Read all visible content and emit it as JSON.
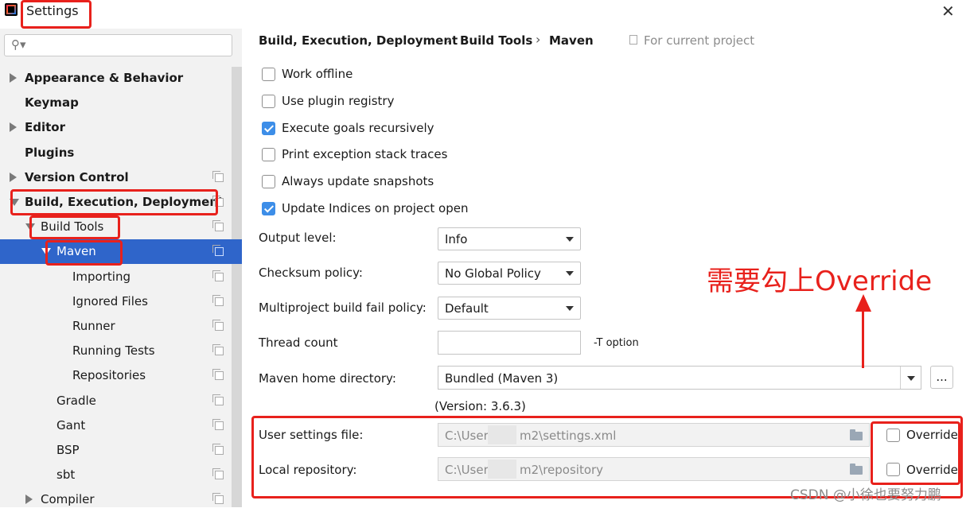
{
  "window": {
    "title": "Settings"
  },
  "sidebar": {
    "search": {
      "placeholder": ""
    },
    "items": [
      {
        "label": "Appearance & Behavior",
        "arrow": "right",
        "bold": true,
        "indent": 0
      },
      {
        "label": "Keymap",
        "arrow": "none",
        "bold": true,
        "indent": 0
      },
      {
        "label": "Editor",
        "arrow": "right",
        "bold": true,
        "indent": 0
      },
      {
        "label": "Plugins",
        "arrow": "none",
        "bold": true,
        "indent": 0
      },
      {
        "label": "Version Control",
        "arrow": "right",
        "bold": true,
        "indent": 0
      },
      {
        "label": "Build, Execution, Deployment",
        "arrow": "down",
        "bold": true,
        "indent": 0
      },
      {
        "label": "Build Tools",
        "arrow": "down",
        "bold": false,
        "indent": 1
      },
      {
        "label": "Maven",
        "arrow": "down",
        "bold": false,
        "indent": 2,
        "selected": true
      },
      {
        "label": "Importing",
        "arrow": "none",
        "bold": false,
        "indent": 3
      },
      {
        "label": "Ignored Files",
        "arrow": "none",
        "bold": false,
        "indent": 3
      },
      {
        "label": "Runner",
        "arrow": "none",
        "bold": false,
        "indent": 3
      },
      {
        "label": "Running Tests",
        "arrow": "none",
        "bold": false,
        "indent": 3
      },
      {
        "label": "Repositories",
        "arrow": "none",
        "bold": false,
        "indent": 3
      },
      {
        "label": "Gradle",
        "arrow": "none",
        "bold": false,
        "indent": 2
      },
      {
        "label": "Gant",
        "arrow": "none",
        "bold": false,
        "indent": 2
      },
      {
        "label": "BSP",
        "arrow": "none",
        "bold": false,
        "indent": 2
      },
      {
        "label": "sbt",
        "arrow": "none",
        "bold": false,
        "indent": 2
      },
      {
        "label": "Compiler",
        "arrow": "right",
        "bold": false,
        "indent": 1
      }
    ]
  },
  "breadcrumb": {
    "parts": [
      "Build, Execution, Deployment",
      "Build Tools",
      "Maven"
    ],
    "separator": "›",
    "scope": "For current project"
  },
  "options": [
    {
      "label": "Work offline",
      "checked": false
    },
    {
      "label": "Use plugin registry",
      "checked": false
    },
    {
      "label": "Execute goals recursively",
      "checked": true
    },
    {
      "label": "Print exception stack traces",
      "checked": false
    },
    {
      "label": "Always update snapshots",
      "checked": false
    },
    {
      "label": "Update Indices on project open",
      "checked": true
    }
  ],
  "fields": {
    "output_level": {
      "label": "Output level:",
      "value": "Info"
    },
    "checksum_policy": {
      "label": "Checksum policy:",
      "value": "No Global Policy"
    },
    "multiproject_fail": {
      "label": "Multiproject build fail policy:",
      "value": "Default"
    },
    "thread_count": {
      "label": "Thread count",
      "value": "",
      "hint": "-T option"
    },
    "maven_home": {
      "label": "Maven home directory:",
      "value": "Bundled (Maven 3)",
      "browse": "...",
      "version": "(Version: 3.6.3)"
    },
    "user_settings": {
      "label": "User settings file:",
      "value_prefix": "C:\\User",
      "value_suffix": "m2\\settings.xml",
      "override_label": "Override",
      "override_checked": false
    },
    "local_repo": {
      "label": "Local repository:",
      "value_prefix": "C:\\User",
      "value_suffix": "m2\\repository",
      "override_label": "Override",
      "override_checked": false
    }
  },
  "annotation": {
    "text": "需要勾上Override",
    "color": "#e8211c"
  },
  "watermark": "CSDN @小徐也要努力鹏",
  "colors": {
    "selection": "#2f65ca",
    "checkbox_checked": "#3d8ee8",
    "annotation": "#e8211c"
  }
}
